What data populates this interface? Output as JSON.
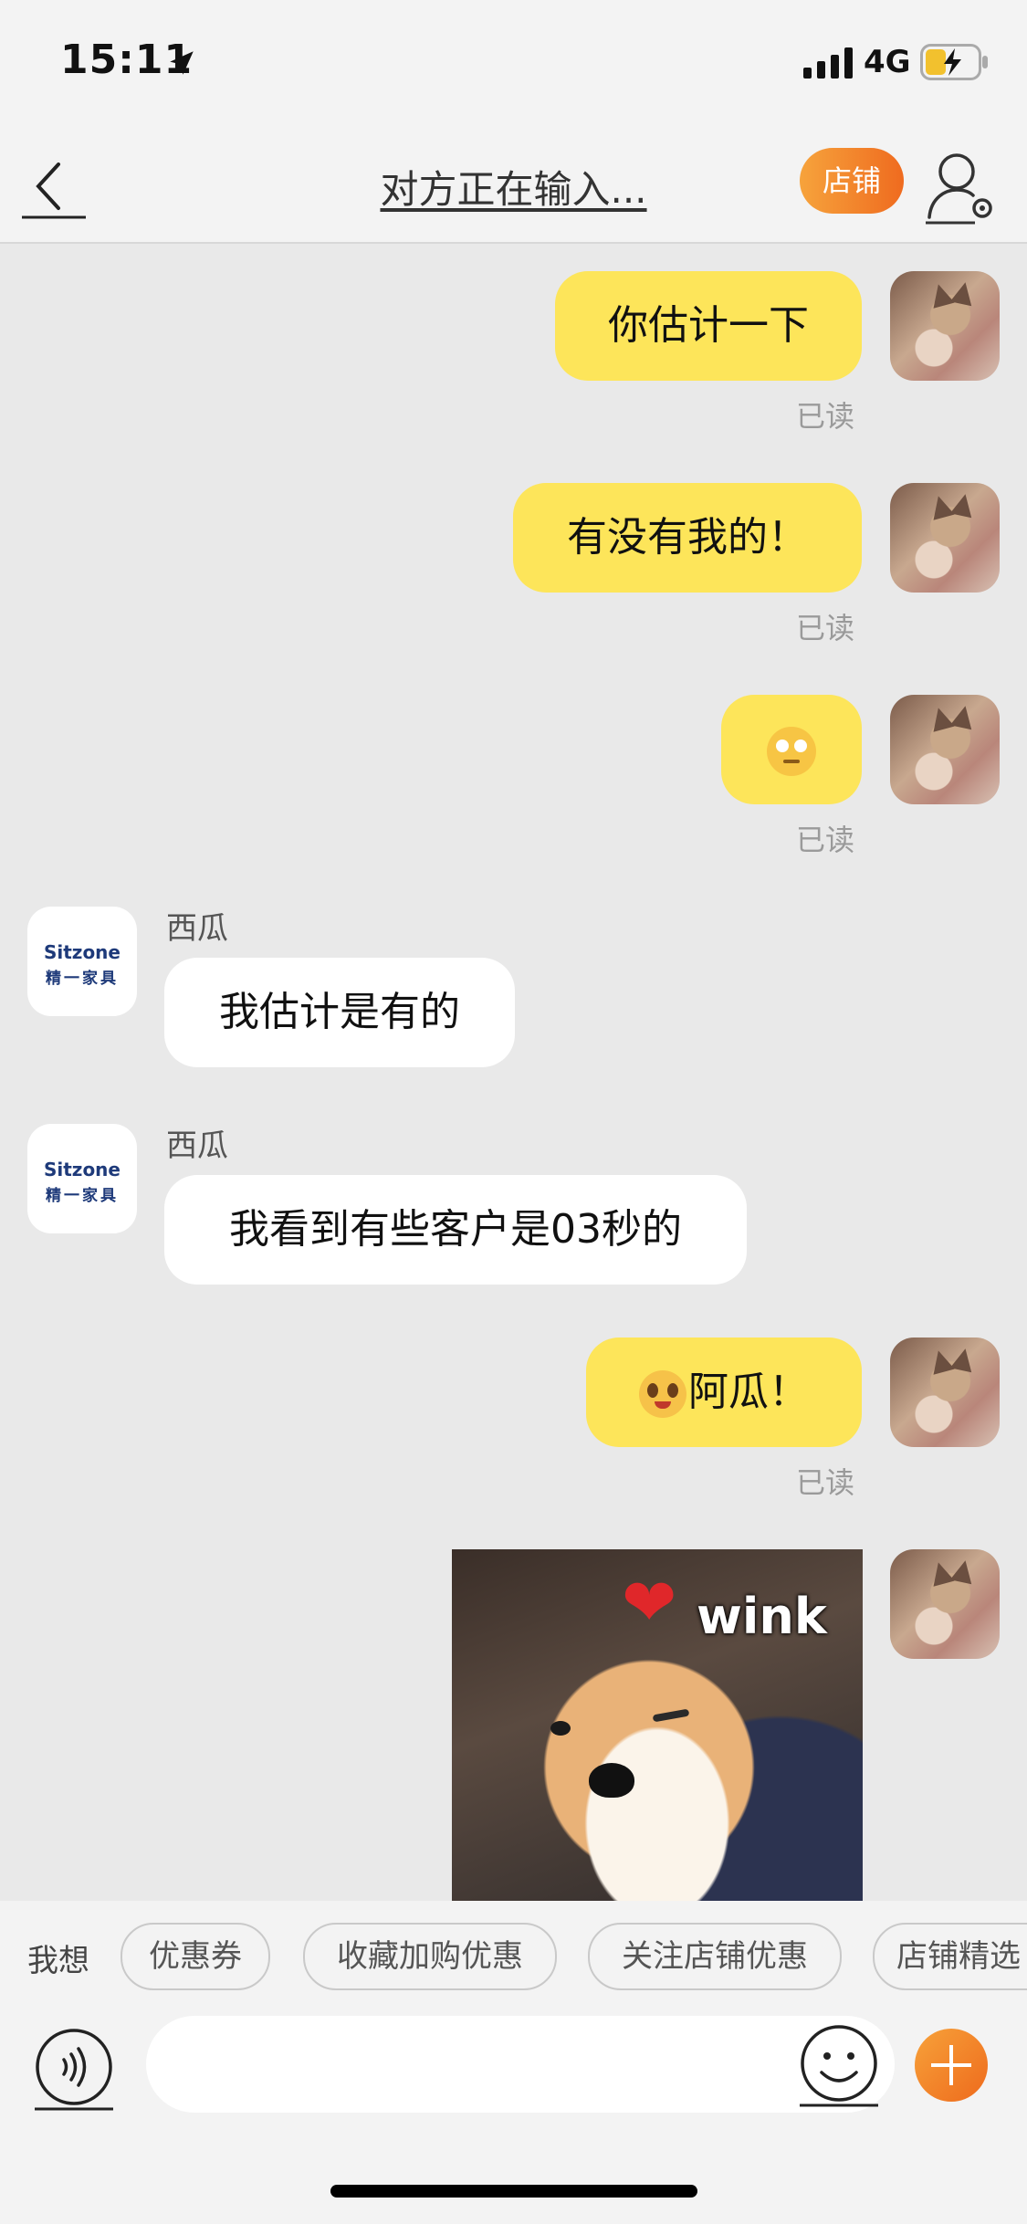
{
  "status_bar": {
    "time": "15:11",
    "network": "4G"
  },
  "nav": {
    "title": "对方正在输入...",
    "shop_label": "店铺"
  },
  "brand_avatar": {
    "top": "Sitzone",
    "bottom": "精一家具"
  },
  "messages": [
    {
      "from": "me",
      "text": "你估计一下",
      "status": "已读"
    },
    {
      "from": "me",
      "text": "有没有我的！",
      "status": "已读"
    },
    {
      "from": "me",
      "text": "",
      "emoji": "thinking-face",
      "status": "已读"
    },
    {
      "from": "them",
      "sender": "西瓜",
      "text": "我估计是有的"
    },
    {
      "from": "them",
      "sender": "西瓜",
      "text": "我看到有些客户是03秒的"
    },
    {
      "from": "me",
      "text": "阿瓜！",
      "emoji": "crying-face",
      "status": "已读"
    },
    {
      "from": "me",
      "sticker": "shiba-dog",
      "sticker_text": "wink"
    }
  ],
  "quick_bar": {
    "label": "我想",
    "chips": [
      "优惠券",
      "收藏加购优惠",
      "关注店铺优惠",
      "店铺精选"
    ]
  },
  "input": {
    "value": "",
    "placeholder": ""
  },
  "colors": {
    "my_bubble": "#fde55a",
    "their_bubble": "#ffffff",
    "accent": "#ef6b1f"
  }
}
